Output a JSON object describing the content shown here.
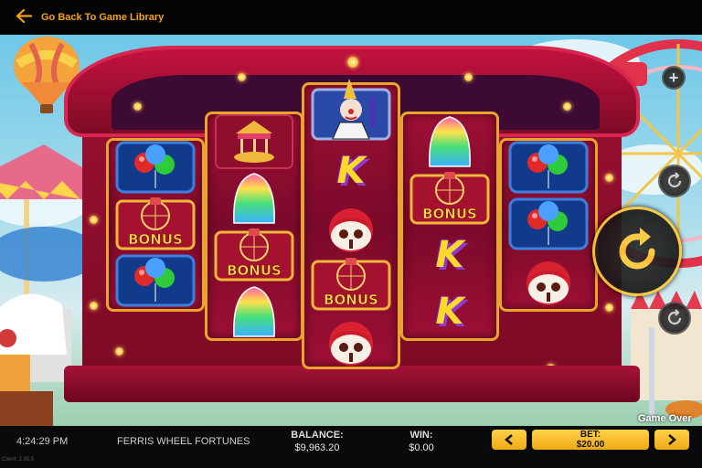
{
  "top_bar": {
    "back_label": "Go Back To Game Library"
  },
  "reels": [
    {
      "symbols": [
        "balloons",
        "bonus",
        "balloons"
      ]
    },
    {
      "symbols": [
        "carousel",
        "cake",
        "bonus",
        "cake"
      ]
    },
    {
      "symbols": [
        "clown",
        "k",
        "candy-apple",
        "bonus",
        "candy-apple"
      ]
    },
    {
      "symbols": [
        "cake",
        "bonus",
        "k",
        "k"
      ]
    },
    {
      "symbols": [
        "balloons",
        "balloons",
        "candy-apple"
      ]
    }
  ],
  "symbol_labels": {
    "bonus": "BONUS",
    "k": "K"
  },
  "status": {
    "game_over": "Game Over"
  },
  "bottom_bar": {
    "time": "4:24:29 PM",
    "game_name": "FERRIS WHEEL FORTUNES",
    "balance_label": "BALANCE:",
    "balance_value": "$9,963.20",
    "win_label": "WIN:",
    "win_value": "$0.00",
    "bet_label": "BET:",
    "bet_value": "$20.00",
    "client_version": "Client: 2.35.5"
  },
  "colors": {
    "accent": "#f2a21b",
    "frame_red": "#9a1032",
    "reel_border": "#e9a52a"
  }
}
